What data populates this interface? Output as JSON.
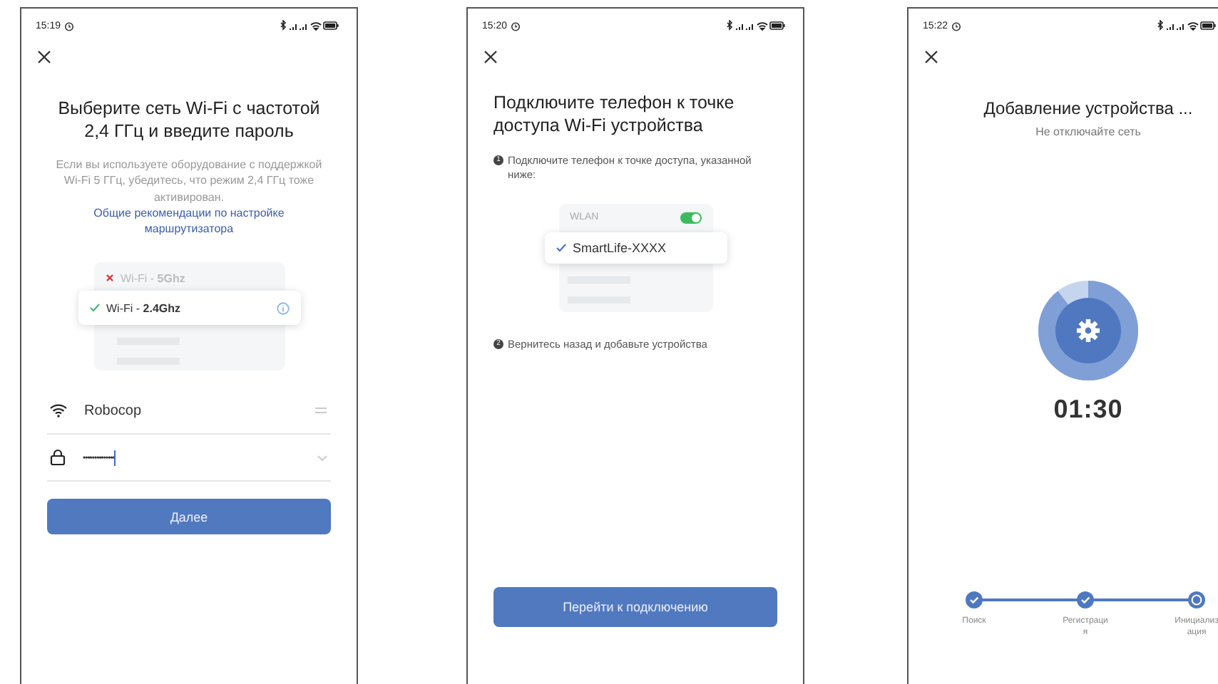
{
  "screens": [
    {
      "kind": "wifi_form",
      "time": "15:19",
      "title": "Выберите сеть Wi-Fi с частотой 2,4 ГГц и введите пароль",
      "description": "Если вы используете оборудование с поддержкой Wi-Fi 5 ГГц, убедитесь, что режим 2,4 ГГц тоже активирован.",
      "link": "Общие рекомендации по настройке маршрутизатора",
      "networks": [
        {
          "label": "Wi-Fi - **5Ghz**",
          "selected": false
        },
        {
          "label": "Wi-Fi - **2.4Ghz**",
          "selected": true
        }
      ],
      "network_name": "Robocop",
      "password": "••••••••••••••",
      "button": "Далее"
    },
    {
      "kind": "hotspot",
      "time": "15:20",
      "title": "Подключите телефон к точке доступа Wi-Fi устройства",
      "steps": [
        {
          "marker": "1",
          "text": "Подключите телефон к точке доступа, указанной ниже:"
        },
        {
          "marker": "2",
          "text": "Вернитесь назад и добавьте устройства"
        }
      ],
      "wlan_label": "WLAN",
      "wlan_on": true,
      "network": "SmartLife-XXXX",
      "button": "Перейти к подключению"
    },
    {
      "kind": "progress",
      "time": "15:22",
      "title": "Добавление устройства ...",
      "subtitle": "Не отключайте сеть",
      "timer": "01:30",
      "stages": [
        {
          "label": "Поиск",
          "done": true
        },
        {
          "label": "Регистрация",
          "done": true
        },
        {
          "label": "Инициализация",
          "done": false
        }
      ]
    }
  ]
}
